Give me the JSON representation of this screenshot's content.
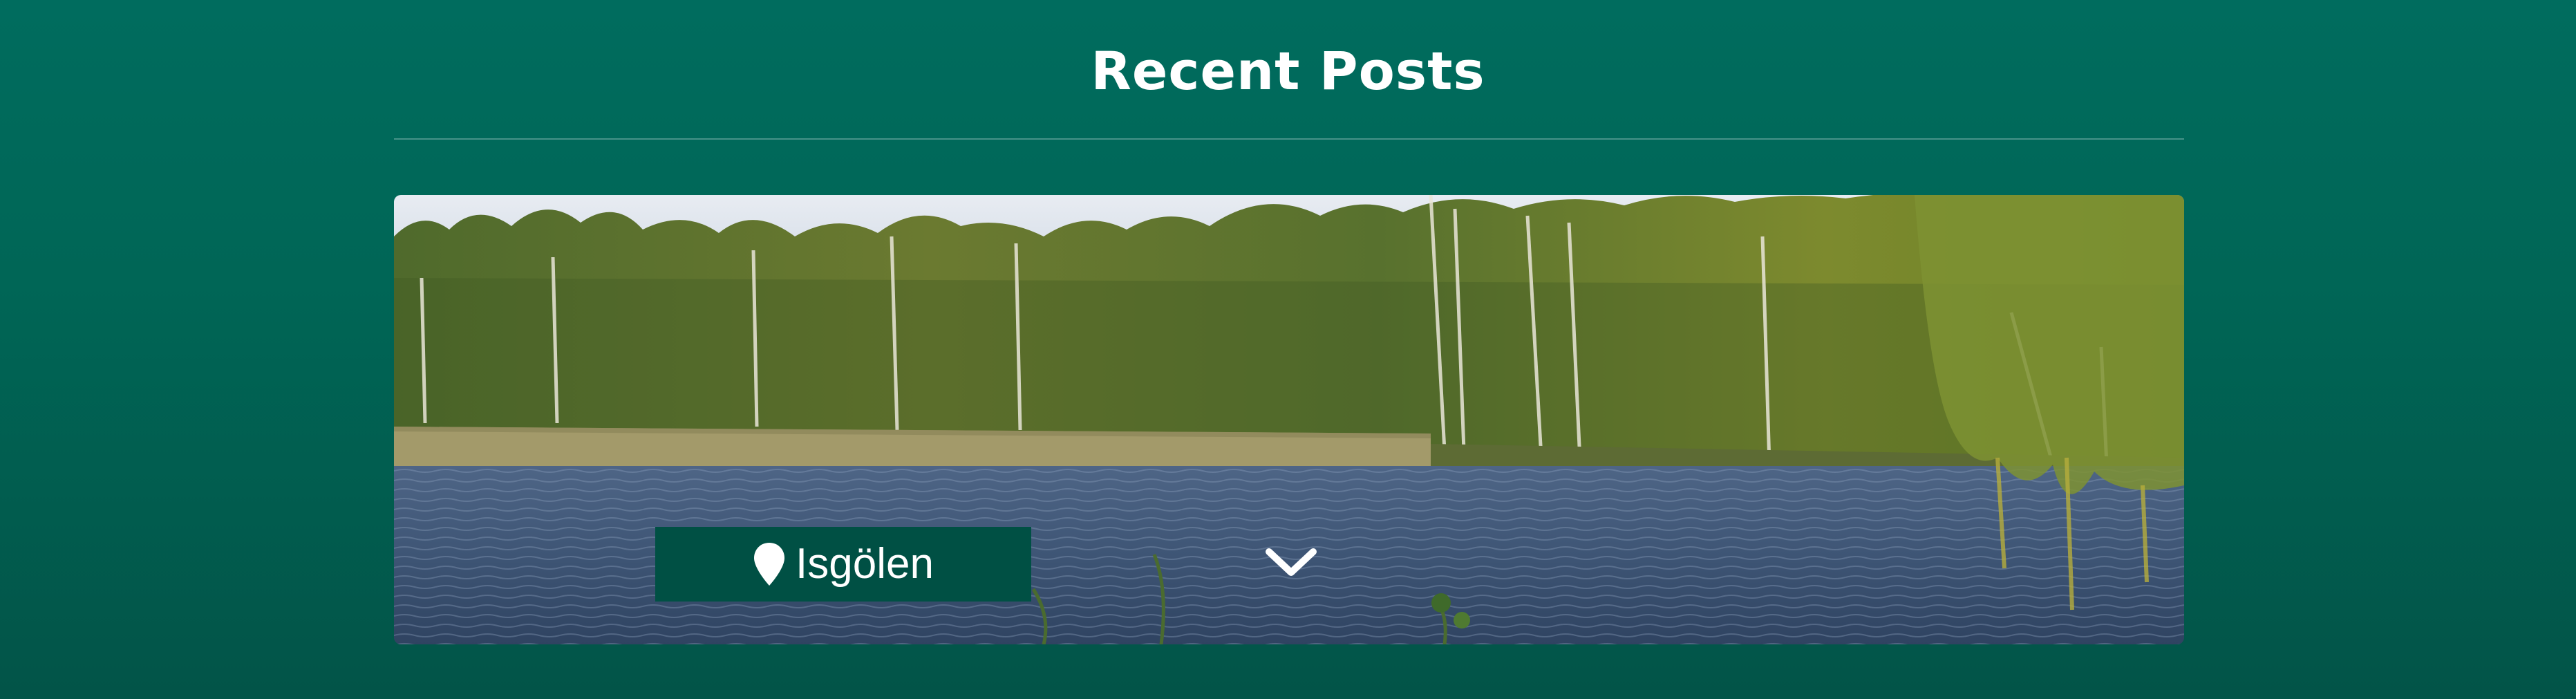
{
  "section": {
    "title": "Recent Posts"
  },
  "posts": [
    {
      "location": "Isgölen",
      "location_icon": "map-pin-icon",
      "expand_icon": "chevron-down-icon"
    }
  ],
  "colors": {
    "background_top": "#006c5e",
    "background_bottom": "#025448",
    "badge": "#005044",
    "text": "#ffffff"
  }
}
